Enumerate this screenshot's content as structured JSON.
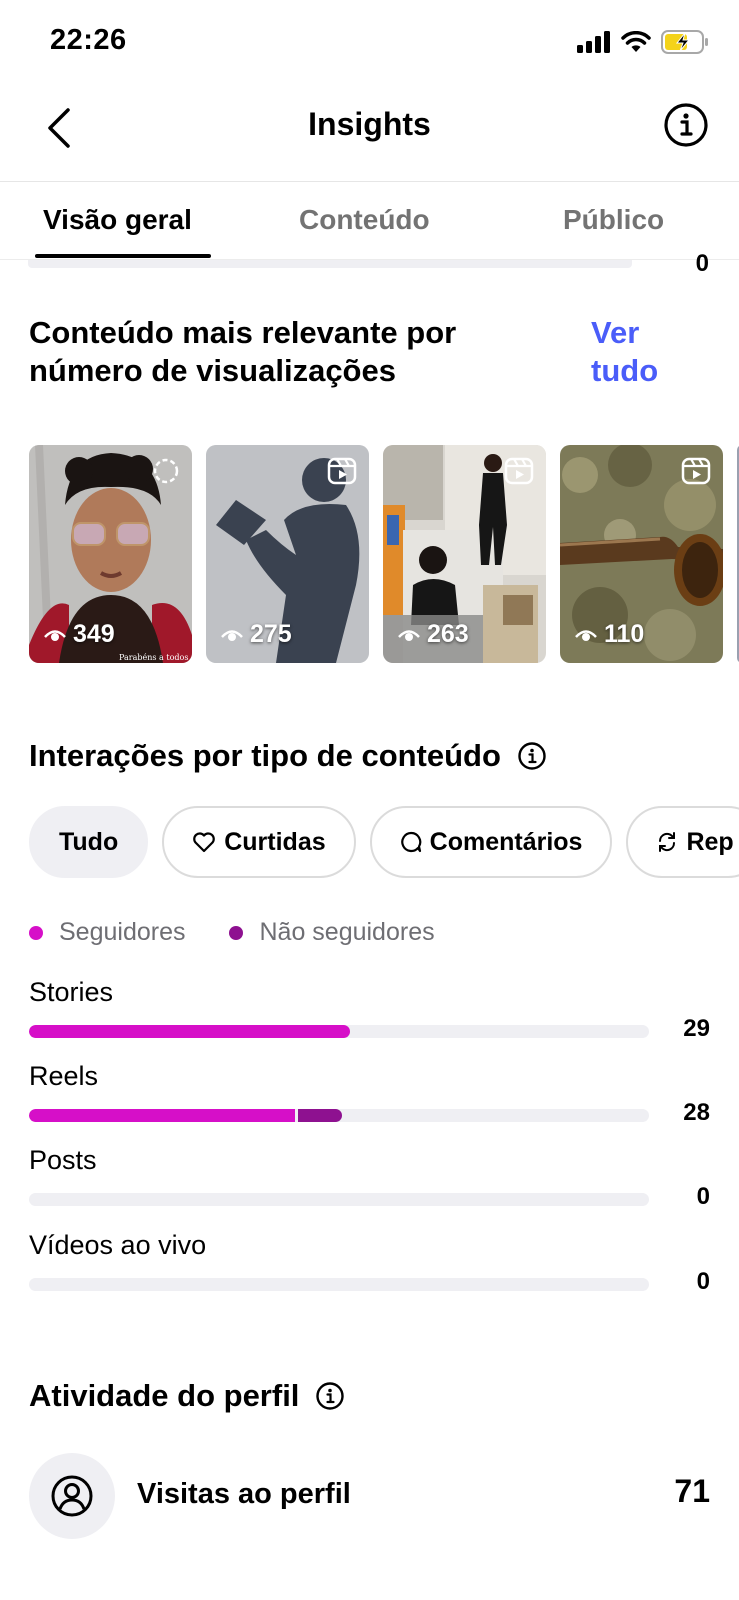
{
  "status_bar": {
    "time": "22:26"
  },
  "header": {
    "title": "Insights"
  },
  "tabs": [
    {
      "label": "Visão geral"
    },
    {
      "label": "Conteúdo"
    },
    {
      "label": "Público"
    }
  ],
  "previous_row": {
    "value": "0"
  },
  "top_content": {
    "title_line1": "Conteúdo mais relevante por",
    "title_line2": "número de visualizações",
    "see_all_line1": "Ver",
    "see_all_line2": "tudo",
    "items": [
      {
        "views": "349",
        "type": "story"
      },
      {
        "views": "275",
        "type": "reel"
      },
      {
        "views": "263",
        "type": "reel"
      },
      {
        "views": "110",
        "type": "reel"
      }
    ],
    "story_caption": "Parabéns a todos os"
  },
  "interactions": {
    "title": "Interações por tipo de conteúdo",
    "filters": [
      "Tudo",
      "Curtidas",
      "Comentários",
      "Rep"
    ],
    "legend": [
      {
        "label": "Seguidores",
        "color": "#d60fc8"
      },
      {
        "label": "Não seguidores",
        "color": "#8e1190"
      }
    ],
    "rows": [
      {
        "label": "Stories",
        "value": "29",
        "followers": 29,
        "non_followers": 0
      },
      {
        "label": "Reels",
        "value": "28",
        "followers": 24,
        "non_followers": 4
      },
      {
        "label": "Posts",
        "value": "0",
        "followers": 0,
        "non_followers": 0
      },
      {
        "label": "Vídeos ao vivo",
        "value": "0",
        "followers": 0,
        "non_followers": 0
      }
    ],
    "scale_max": 56
  },
  "profile_activity": {
    "title": "Atividade do perfil",
    "visits_label": "Visitas ao perfil",
    "visits_value": "71"
  }
}
